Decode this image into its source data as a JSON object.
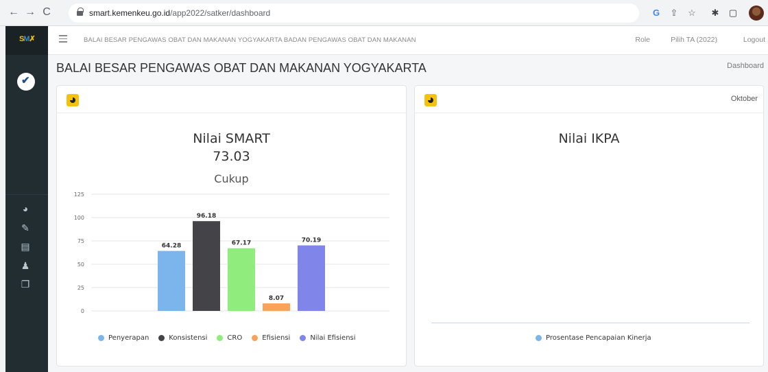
{
  "browser": {
    "url_host": "smart.kemenkeu.go.id",
    "url_path": "/app2022/satker/dashboard",
    "icons": [
      "google-icon",
      "share-icon",
      "star-icon",
      "extension-icon",
      "sidepanel-icon",
      "profile-avatar"
    ]
  },
  "sidebar": {
    "logo": "SMART",
    "items": [
      "dashboard-icon",
      "edit-icon",
      "document-icon",
      "user-icon",
      "copy-icon"
    ]
  },
  "header": {
    "title": "BALAI BESAR PENGAWAS OBAT DAN MAKANAN YOGYAKARTA BADAN PENGAWAS OBAT DAN MAKANAN",
    "role": "Role",
    "ta": "Pilih TA (2022)",
    "logout": "Logout"
  },
  "page": {
    "title": "BALAI BESAR PENGAWAS OBAT DAN MAKANAN YOGYAKARTA",
    "breadcrumb": "Dashboard"
  },
  "smart_card": {
    "title": "Nilai SMART",
    "score": "73.03",
    "category": "Cukup"
  },
  "ikpa_card": {
    "month": "Oktober",
    "title": "Nilai IKPA",
    "legend": "Prosentase Pencapaian Kinerja",
    "legend_color": "#7cb5ec"
  },
  "chart_data": {
    "type": "bar",
    "categories": [
      "Penyerapan",
      "Konsistensi",
      "CRO",
      "Efisiensi",
      "Nilai Efisiensi"
    ],
    "values": [
      64.28,
      96.18,
      67.17,
      8.07,
      70.19
    ],
    "labels": [
      "64.28",
      "96.18",
      "67.17",
      "8.07",
      "70.19"
    ],
    "colors": [
      "#7cb5ec",
      "#434348",
      "#90ed7d",
      "#f7a35c",
      "#8085e9"
    ],
    "ylim": [
      0,
      125
    ],
    "yticks": [
      "0",
      "25",
      "50",
      "75",
      "100",
      "125"
    ],
    "grid": true,
    "legend_position": "bottom"
  }
}
